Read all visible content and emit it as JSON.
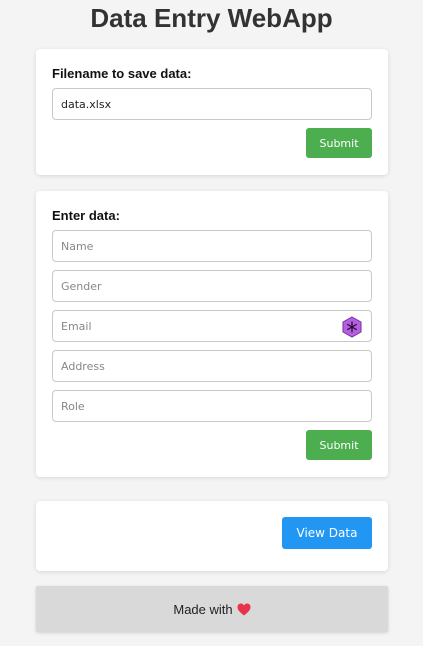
{
  "app": {
    "title": "Data Entry WebApp"
  },
  "file_form": {
    "label": "Filename to save data:",
    "filename_value": "data.xlsx",
    "submit_label": "Submit"
  },
  "data_form": {
    "label": "Enter data:",
    "fields": [
      {
        "placeholder": "Name"
      },
      {
        "placeholder": "Gender"
      },
      {
        "placeholder": "Email"
      },
      {
        "placeholder": "Address"
      },
      {
        "placeholder": "Role"
      }
    ],
    "submit_label": "Submit",
    "field_icon": "password-manager-icon"
  },
  "view_panel": {
    "view_label": "View Data"
  },
  "footer": {
    "text": "Made with",
    "icon": "heart-icon"
  },
  "colors": {
    "green_button": "#4cae4f",
    "blue_button": "#2196f3",
    "heart": "#e8334a",
    "icon_purple": "#b45fe0"
  }
}
